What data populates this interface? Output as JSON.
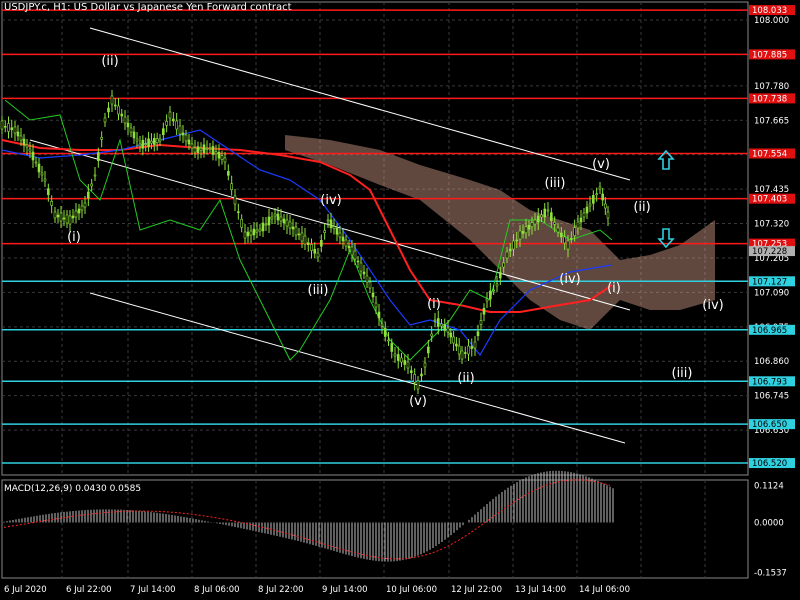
{
  "header": {
    "title": "USDJPY.c, H1:  US Dollar vs Japanese Yen Forward contract"
  },
  "colors": {
    "background": "#000000",
    "grid": "#3a3a3a",
    "axis_text": "#ffffff",
    "bull_candle": "#8fe23c",
    "bear_candle": "#8fe23c",
    "resistance_line": "#ff1a1a",
    "support_line": "#2fd0e0",
    "ma_red": "#ff2020",
    "ma_blue": "#1a3cff",
    "ma_green": "#22cc22",
    "channel": "#ffffff",
    "cloud": "#d4a08c",
    "wave_label": "#ffffff",
    "macd_hist": "#c0c0c0",
    "macd_signal": "#ff2020",
    "label_red": "#e01010",
    "label_cyan": "#2fd0e0",
    "arrow": "#2fd0e0",
    "current_price_tag": "#b0b0b0"
  },
  "chart_data": {
    "type": "candlestick",
    "symbol": "USDJPY.c",
    "timeframe": "H1",
    "ylim": [
      106.48,
      108.06
    ],
    "y_ticks": [
      "108.000",
      "107.885",
      "107.780",
      "107.665",
      "107.550",
      "107.435",
      "107.320",
      "107.205",
      "107.090",
      "106.975",
      "106.860",
      "106.745",
      "106.630"
    ],
    "x_ticks": [
      "6 Jul 2020",
      "6 Jul 22:00",
      "7 Jul 14:00",
      "8 Jul 06:00",
      "8 Jul 22:00",
      "9 Jul 14:00",
      "10 Jul 06:00",
      "12 Jul 22:00",
      "13 Jul 14:00",
      "14 Jul 06:00"
    ],
    "current_price": "107.228",
    "resistance_levels": [
      "108.033",
      "107.885",
      "107.738",
      "107.554",
      "107.403",
      "107.253"
    ],
    "support_levels": [
      "107.127",
      "106.965",
      "106.793",
      "106.650",
      "106.520"
    ],
    "wave_labels": [
      {
        "text": "(ii)",
        "x": 110,
        "y": 65
      },
      {
        "text": "(i)",
        "x": 74,
        "y": 241
      },
      {
        "text": "(iv)",
        "x": 331,
        "y": 204
      },
      {
        "text": "(iii)",
        "x": 318,
        "y": 294
      },
      {
        "text": "(i)",
        "x": 434,
        "y": 308
      },
      {
        "text": "(ii)",
        "x": 466,
        "y": 382
      },
      {
        "text": "(v)",
        "x": 418,
        "y": 405
      },
      {
        "text": "(iii)",
        "x": 555,
        "y": 187
      },
      {
        "text": "(v)",
        "x": 601,
        "y": 168
      },
      {
        "text": "(iv)",
        "x": 570,
        "y": 283
      },
      {
        "text": "(ii)",
        "x": 642,
        "y": 211
      },
      {
        "text": "(i)",
        "x": 614,
        "y": 292
      },
      {
        "text": "(iv)",
        "x": 713,
        "y": 309
      },
      {
        "text": "(iii)",
        "x": 682,
        "y": 377
      }
    ],
    "macd": {
      "label": "MACD(12,26,9) 0.0430 0.0585",
      "y_ticks": [
        "0.1124",
        "0.0000",
        "-0.1537"
      ],
      "ylim": [
        -0.17,
        0.13
      ]
    }
  }
}
